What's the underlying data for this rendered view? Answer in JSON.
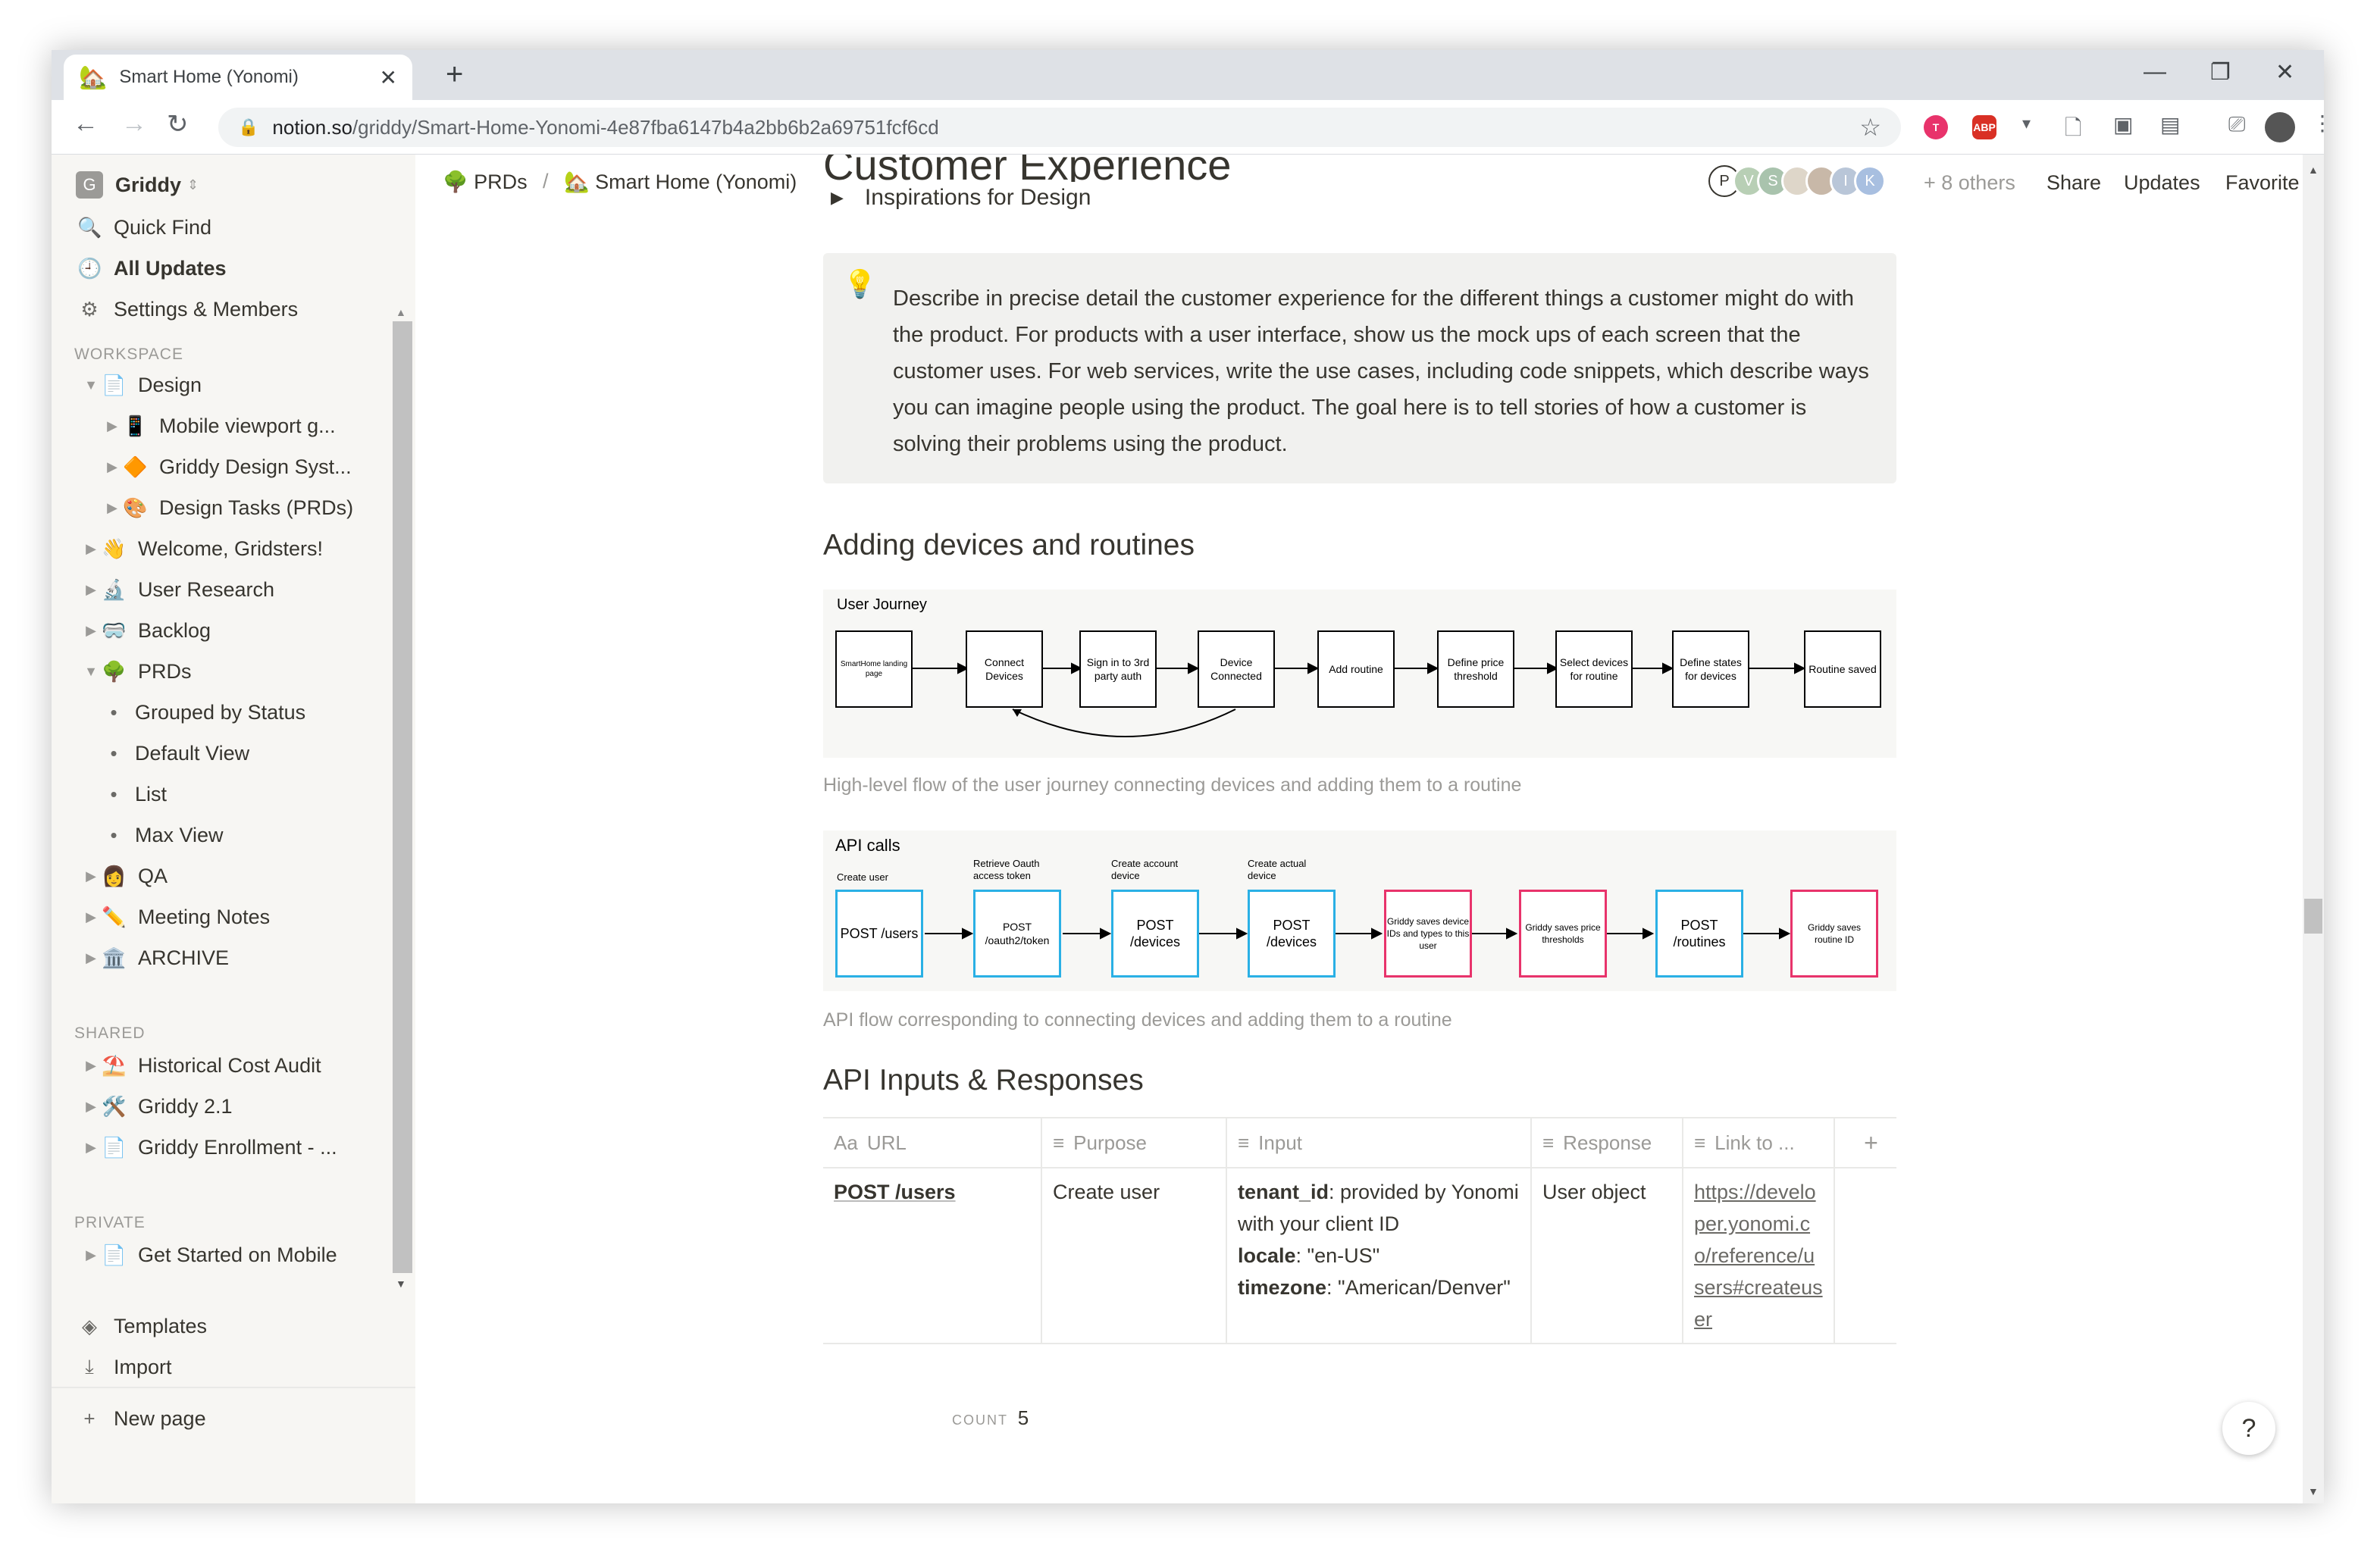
{
  "browser": {
    "tab_title": "Smart Home (Yonomi)",
    "tab_icon": "🏡",
    "url_domain": "notion.so",
    "url_path": "/griddy/Smart-Home-Yonomi-4e87fba6147b4a2bb6b2a69751fcf6cd"
  },
  "sidebar": {
    "workspace_name": "Griddy",
    "workspace_initial": "G",
    "quick_find": "Quick Find",
    "all_updates": "All Updates",
    "settings": "Settings & Members",
    "workspace_header": "WORKSPACE",
    "workspace_items": [
      {
        "label": "Design",
        "icon": "📄"
      },
      {
        "label": "Mobile viewport g...",
        "icon": "📱"
      },
      {
        "label": "Griddy Design Syst...",
        "icon": "🔶"
      },
      {
        "label": "Design Tasks (PRDs)",
        "icon": "🎨"
      },
      {
        "label": "Welcome, Gridsters!",
        "icon": "👋"
      },
      {
        "label": "User Research",
        "icon": "🔬"
      },
      {
        "label": "Backlog",
        "icon": "🥽"
      },
      {
        "label": "PRDs",
        "icon": "🌳"
      },
      {
        "label": "Grouped by Status",
        "icon": "•"
      },
      {
        "label": "Default View",
        "icon": "•"
      },
      {
        "label": "List",
        "icon": "•"
      },
      {
        "label": "Max View",
        "icon": "•"
      },
      {
        "label": "QA",
        "icon": "👩"
      },
      {
        "label": "Meeting Notes",
        "icon": "✏️"
      },
      {
        "label": "ARCHIVE",
        "icon": "🏛️"
      }
    ],
    "shared_header": "SHARED",
    "shared_items": [
      {
        "label": "Historical Cost Audit",
        "icon": "⛱️"
      },
      {
        "label": "Griddy 2.1",
        "icon": "🛠️"
      },
      {
        "label": "Griddy Enrollment - ...",
        "icon": "📄"
      }
    ],
    "private_header": "PRIVATE",
    "private_items": [
      {
        "label": "Get Started on Mobile",
        "icon": "📄"
      }
    ],
    "templates": "Templates",
    "import": "Import",
    "new_page": "New page"
  },
  "topbar": {
    "crumb_1": "PRDs",
    "crumb_1_icon": "🌳",
    "crumb_sep": "/",
    "crumb_2": "Smart Home (Yonomi)",
    "crumb_2_icon": "🏡",
    "avatars": [
      "P",
      "V",
      "S",
      "",
      "",
      "I",
      "K"
    ],
    "others": "+ 8 others",
    "share": "Share",
    "updates": "Updates",
    "favorite": "Favorite",
    "more": "•••"
  },
  "page": {
    "heading": "Customer Experience",
    "toggle": "Inspirations for Design",
    "callout_icon": "💡",
    "callout_text": "Describe in precise detail the customer experience for the different things a customer might do with the product. For products with a user interface, show us the mock ups of each screen that the customer uses. For web services, write the use cases, including code snippets, which describe ways you can imagine people using the product. The goal here is to tell stories of how a customer is solving their problems using the product.",
    "h2_devices": "Adding devices and routines",
    "journey": {
      "title": "User Journey",
      "steps": [
        "SmartHome landing page",
        "Connect Devices",
        "Sign in to 3rd party auth",
        "Device Connected",
        "Add routine",
        "Define price threshold",
        "Select devices for routine",
        "Define states for devices",
        "Routine saved"
      ]
    },
    "journey_caption": "High-level flow of the user journey connecting devices and adding them to a routine",
    "api": {
      "title": "API calls",
      "steps": [
        {
          "top": "Create user",
          "text": "POST /users",
          "kind": "blue"
        },
        {
          "top": "Retrieve Oauth access token",
          "text": "POST /oauth2/token",
          "kind": "blue"
        },
        {
          "top": "Create account device",
          "text": "POST /devices",
          "kind": "blue"
        },
        {
          "top": "Create actual device",
          "text": "POST /devices",
          "kind": "blue"
        },
        {
          "top": "",
          "text": "Griddy saves device IDs and types to this user",
          "kind": "pink"
        },
        {
          "top": "",
          "text": "Griddy saves price thresholds",
          "kind": "pink"
        },
        {
          "top": "",
          "text": "POST /routines",
          "kind": "blue"
        },
        {
          "top": "",
          "text": "Griddy saves routine ID",
          "kind": "pink"
        }
      ]
    },
    "api_caption": "API flow corresponding to connecting devices and adding them to a routine",
    "h2_api": "API Inputs & Responses",
    "table": {
      "headers": [
        "URL",
        "Purpose",
        "Input",
        "Response",
        "Link to ..."
      ],
      "header_icons": [
        "Aa",
        "≡",
        "≡",
        "≡",
        "≡"
      ],
      "row": {
        "url": "POST /users",
        "purpose": "Create user",
        "input_k1": "tenant_id",
        "input_v1": ": provided by Yonomi with your client ID",
        "input_k2": "locale",
        "input_v2": ": \"en-US\"",
        "input_k3": "timezone",
        "input_v3": ": \"American/Denver\"",
        "response": "User object",
        "link": "https://developer.yonomi.co/reference/users#createuser"
      },
      "count_label": "COUNT",
      "count_value": "5"
    },
    "help": "?"
  }
}
